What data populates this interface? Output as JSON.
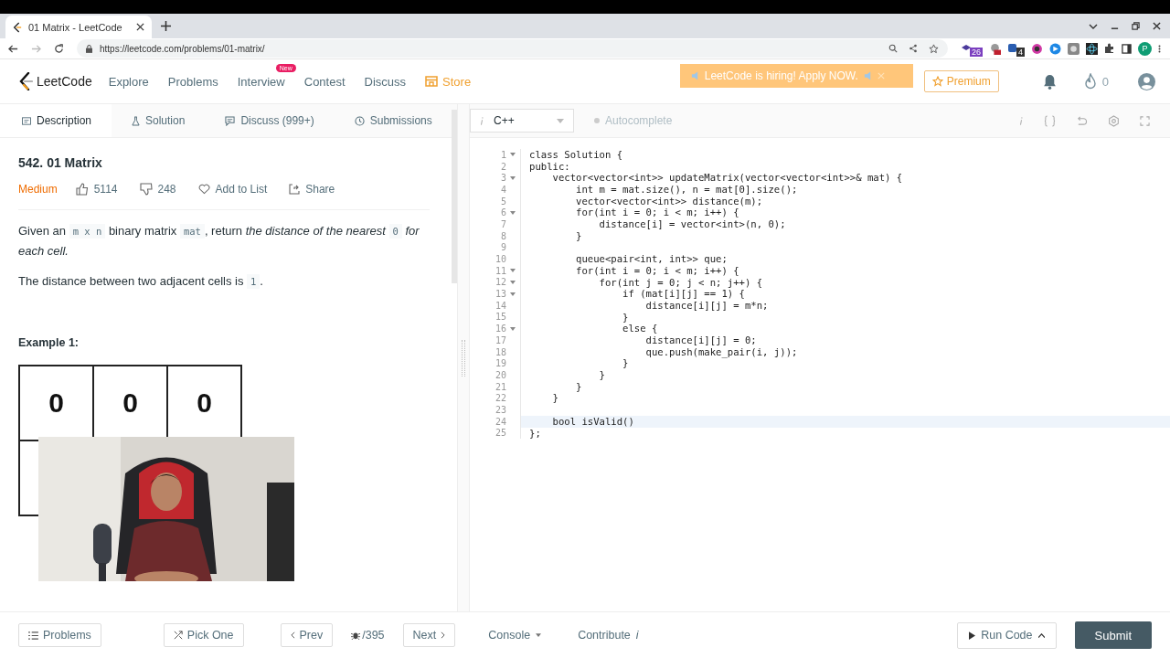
{
  "browser": {
    "tab_title": "01 Matrix - LeetCode",
    "url": "https://leetcode.com/problems/01-matrix/",
    "extension_badges": [
      "26",
      "4"
    ],
    "profile_initial": "P"
  },
  "nav": {
    "brand": "LeetCode",
    "items": [
      {
        "label": "Explore",
        "kind": "plain"
      },
      {
        "label": "Problems",
        "kind": "plain"
      },
      {
        "label": "Interview",
        "badge": "New",
        "kind": "plain"
      },
      {
        "label": "Contest",
        "kind": "plain"
      },
      {
        "label": "Discuss",
        "kind": "plain"
      },
      {
        "label": "Store",
        "kind": "store"
      }
    ],
    "banner": "LeetCode is hiring! Apply NOW.",
    "premium": "Premium",
    "streak": "0"
  },
  "tabs": [
    {
      "label": "Description",
      "selected": true
    },
    {
      "label": "Solution",
      "selected": false
    },
    {
      "label": "Discuss (999+)",
      "selected": false
    },
    {
      "label": "Submissions",
      "selected": false
    }
  ],
  "problem": {
    "title": "542. 01 Matrix",
    "difficulty": "Medium",
    "likes": "5114",
    "dislikes": "248",
    "add_to_list": "Add to List",
    "share": "Share",
    "statement": [
      {
        "text": "Given an ",
        "kind": "plain"
      },
      {
        "text": "m x n",
        "kind": "code"
      },
      {
        "text": " binary matrix ",
        "kind": "plain"
      },
      {
        "text": "mat",
        "kind": "code"
      },
      {
        "text": ", return ",
        "kind": "plain"
      },
      {
        "text": "the distance of the nearest ",
        "kind": "italic"
      },
      {
        "text": "0",
        "kind": "code"
      },
      {
        "text": " for each cell.",
        "kind": "italic"
      }
    ],
    "note": [
      {
        "text": "The distance between two adjacent cells is ",
        "kind": "plain"
      },
      {
        "text": "1",
        "kind": "code"
      },
      {
        "text": ".",
        "kind": "plain"
      }
    ],
    "example_title": "Example 1:",
    "matrix_row": [
      "0",
      "0",
      "0"
    ]
  },
  "editor": {
    "language": "C++",
    "autocomplete": "Autocomplete",
    "autocomplete_on": false,
    "lines": [
      {
        "number": "1",
        "text": "class Solution {",
        "fold": true,
        "current": false
      },
      {
        "number": "2",
        "text": "public:",
        "fold": false,
        "current": false
      },
      {
        "number": "3",
        "text": "    vector<vector<int>> updateMatrix(vector<vector<int>>& mat) {",
        "fold": true,
        "current": false
      },
      {
        "number": "4",
        "text": "        int m = mat.size(), n = mat[0].size();",
        "fold": false,
        "current": false
      },
      {
        "number": "5",
        "text": "        vector<vector<int>> distance(m);",
        "fold": false,
        "current": false
      },
      {
        "number": "6",
        "text": "        for(int i = 0; i < m; i++) {",
        "fold": true,
        "current": false
      },
      {
        "number": "7",
        "text": "            distance[i] = vector<int>(n, 0);",
        "fold": false,
        "current": false
      },
      {
        "number": "8",
        "text": "        }",
        "fold": false,
        "current": false
      },
      {
        "number": "9",
        "fold": false,
        "current": false
      },
      {
        "number": "10",
        "text": "        queue<pair<int, int>> que;",
        "fold": false,
        "current": false
      },
      {
        "number": "11",
        "text": "        for(int i = 0; i < m; i++) {",
        "fold": true,
        "current": false
      },
      {
        "number": "12",
        "text": "            for(int j = 0; j < n; j++) {",
        "fold": true,
        "current": false
      },
      {
        "number": "13",
        "text": "                if (mat[i][j] == 1) {",
        "fold": true,
        "current": false
      },
      {
        "number": "14",
        "text": "                    distance[i][j] = m*n;",
        "fold": false,
        "current": false
      },
      {
        "number": "15",
        "text": "                }",
        "fold": false,
        "current": false
      },
      {
        "number": "16",
        "text": "                else {",
        "fold": true,
        "current": false
      },
      {
        "number": "17",
        "text": "                    distance[i][j] = 0;",
        "fold": false,
        "current": false
      },
      {
        "number": "18",
        "text": "                    que.push(make_pair(i, j));",
        "fold": false,
        "current": false
      },
      {
        "number": "19",
        "text": "                }",
        "fold": false,
        "current": false
      },
      {
        "number": "20",
        "text": "            }",
        "fold": false,
        "current": false
      },
      {
        "number": "21",
        "text": "        }",
        "fold": false,
        "current": false
      },
      {
        "number": "22",
        "text": "    }",
        "fold": false,
        "current": false
      },
      {
        "number": "23",
        "fold": false,
        "current": false
      },
      {
        "number": "24",
        "text": "    bool isValid()",
        "fold": false,
        "current": true
      },
      {
        "number": "25",
        "text": "};",
        "fold": false,
        "current": false
      }
    ]
  },
  "footer": {
    "problems": "Problems",
    "pick_one": "Pick One",
    "prev": "Prev",
    "count": "/395",
    "next": "Next",
    "console": "Console",
    "contribute": "Contribute",
    "contribute_mark": "i",
    "run": "Run Code",
    "submit": "Submit"
  }
}
